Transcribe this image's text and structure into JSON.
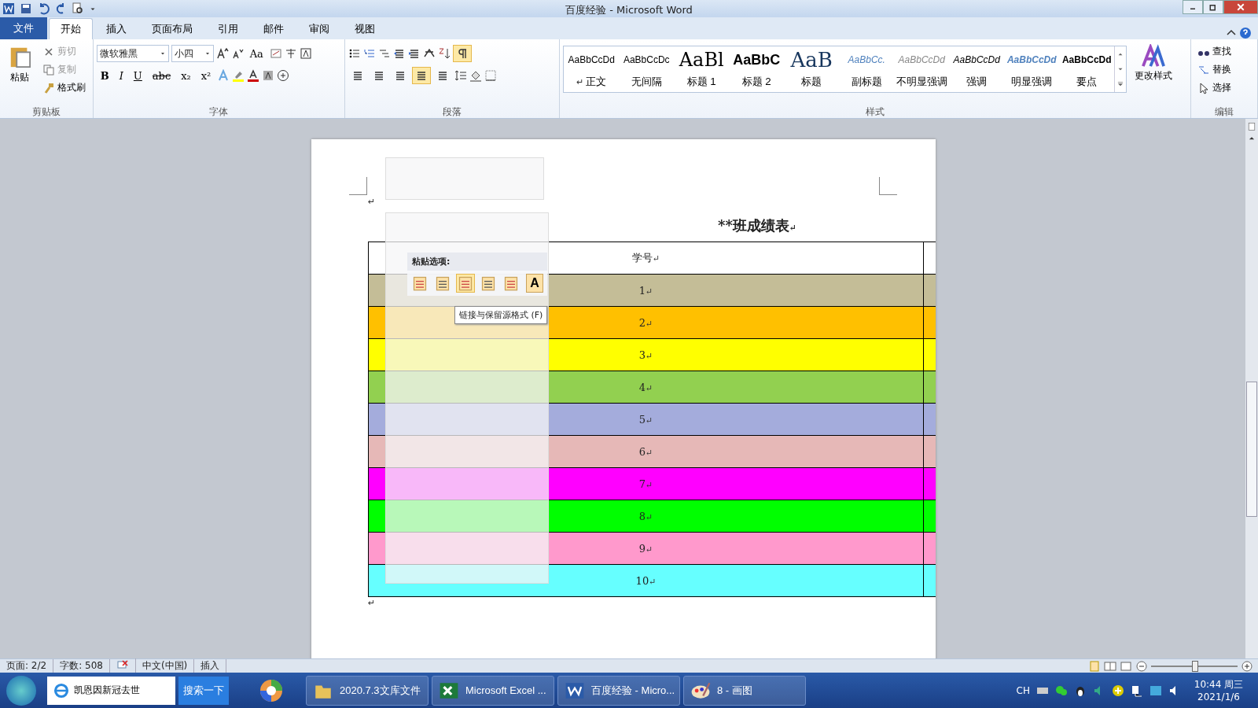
{
  "window": {
    "title": "百度经验 - Microsoft Word"
  },
  "tabs": [
    {
      "label": "文件",
      "kind": "file",
      "selected": false
    },
    {
      "label": "开始",
      "kind": "tab",
      "selected": true
    },
    {
      "label": "插入",
      "kind": "tab",
      "selected": false
    },
    {
      "label": "页面布局",
      "kind": "tab",
      "selected": false
    },
    {
      "label": "引用",
      "kind": "tab",
      "selected": false
    },
    {
      "label": "邮件",
      "kind": "tab",
      "selected": false
    },
    {
      "label": "审阅",
      "kind": "tab",
      "selected": false
    },
    {
      "label": "视图",
      "kind": "tab",
      "selected": false
    }
  ],
  "clipboard": {
    "label": "剪贴板",
    "paste": "粘贴",
    "items": [
      {
        "label": "剪切",
        "disabled": true
      },
      {
        "label": "复制",
        "disabled": true
      },
      {
        "label": "格式刷",
        "disabled": false
      }
    ]
  },
  "font": {
    "label": "字体",
    "family": "微软雅黑",
    "size": "小四",
    "case_button": "Aa",
    "format_buttons": [
      "B",
      "I",
      "U",
      "abc",
      "x₂",
      "x²"
    ]
  },
  "paragraph": {
    "label": "段落",
    "show_marks": {
      "on": true
    },
    "align": [
      {
        "selected": false
      },
      {
        "selected": false
      },
      {
        "selected": false
      },
      {
        "selected": true
      },
      {
        "selected": false
      }
    ]
  },
  "styles": {
    "label": "样式",
    "items": [
      {
        "preview": "AaBbCcDd",
        "name": "正文",
        "mark": "↵",
        "kind": "normal"
      },
      {
        "preview": "AaBbCcDc",
        "name": "无间隔",
        "kind": "normal"
      },
      {
        "preview": "AaBl",
        "name": "标题 1",
        "kind": "h1"
      },
      {
        "preview": "AaBbC",
        "name": "标题 2",
        "kind": "h2"
      },
      {
        "preview": "AaB",
        "name": "标题",
        "kind": "title"
      },
      {
        "preview": "AaBbCc.",
        "name": "副标题",
        "kind": "subtitle"
      },
      {
        "preview": "AaBbCcDd",
        "name": "不明显强调",
        "kind": "subtle"
      },
      {
        "preview": "AaBbCcDd",
        "name": "强调",
        "kind": "emphasis"
      },
      {
        "preview": "AaBbCcDd",
        "name": "明显强调",
        "kind": "intense"
      },
      {
        "preview": "AaBbCcDd",
        "name": "要点",
        "kind": "strong"
      }
    ],
    "change": "更改样式"
  },
  "editing": {
    "label": "编辑",
    "items": [
      "查找",
      "替换",
      "选择"
    ]
  },
  "document": {
    "first_mark": "↵",
    "title": "**班成绩表",
    "title_mark": "↵",
    "table": {
      "header": {
        "text": "学号",
        "mark": "↵"
      },
      "rows": [
        {
          "text": "1",
          "mark": "↵",
          "color": "#c4bd97"
        },
        {
          "text": "2",
          "mark": "↵",
          "color": "#ffc000"
        },
        {
          "text": "3",
          "mark": "↵",
          "color": "#ffff00"
        },
        {
          "text": "4",
          "mark": "↵",
          "color": "#92d050"
        },
        {
          "text": "5",
          "mark": "↵",
          "color": "#a4acdc"
        },
        {
          "text": "6",
          "mark": "↵",
          "color": "#e6b8b7"
        },
        {
          "text": "7",
          "mark": "↵",
          "color": "#ff00ff"
        },
        {
          "text": "8",
          "mark": "↵",
          "color": "#00ff00"
        },
        {
          "text": "9",
          "mark": "↵",
          "color": "#ff99cc"
        },
        {
          "text": "10",
          "mark": "↵",
          "color": "#66ffff"
        }
      ]
    },
    "end_mark": "↵",
    "paste_options": {
      "title": "粘贴选项:",
      "options": [
        {
          "selected": false
        },
        {
          "selected": false
        },
        {
          "selected": true
        },
        {
          "selected": false
        },
        {
          "selected": false
        },
        {
          "selected": false,
          "kind": "text",
          "glyph": "A"
        }
      ],
      "tooltip": "链接与保留源格式 (F)"
    }
  },
  "status_bar": {
    "page": "页面: 2/2",
    "words": "字数: 508",
    "language": "中文(中国)",
    "mode": "插入",
    "zoom": {
      "level": 0.5
    }
  },
  "taskbar": {
    "search": {
      "value": "凯恩因新冠去世",
      "button": "搜索一下"
    },
    "tasks": [
      {
        "label": "2020.7.3文库文件",
        "kind": "folder"
      },
      {
        "label": "Microsoft Excel ...",
        "kind": "excel"
      },
      {
        "label": "百度经验 - Micro...",
        "kind": "word"
      },
      {
        "label": "8 - 画图",
        "kind": "paint"
      }
    ],
    "ime": "CH",
    "time": "10:44 周三",
    "date": "2021/1/6"
  }
}
